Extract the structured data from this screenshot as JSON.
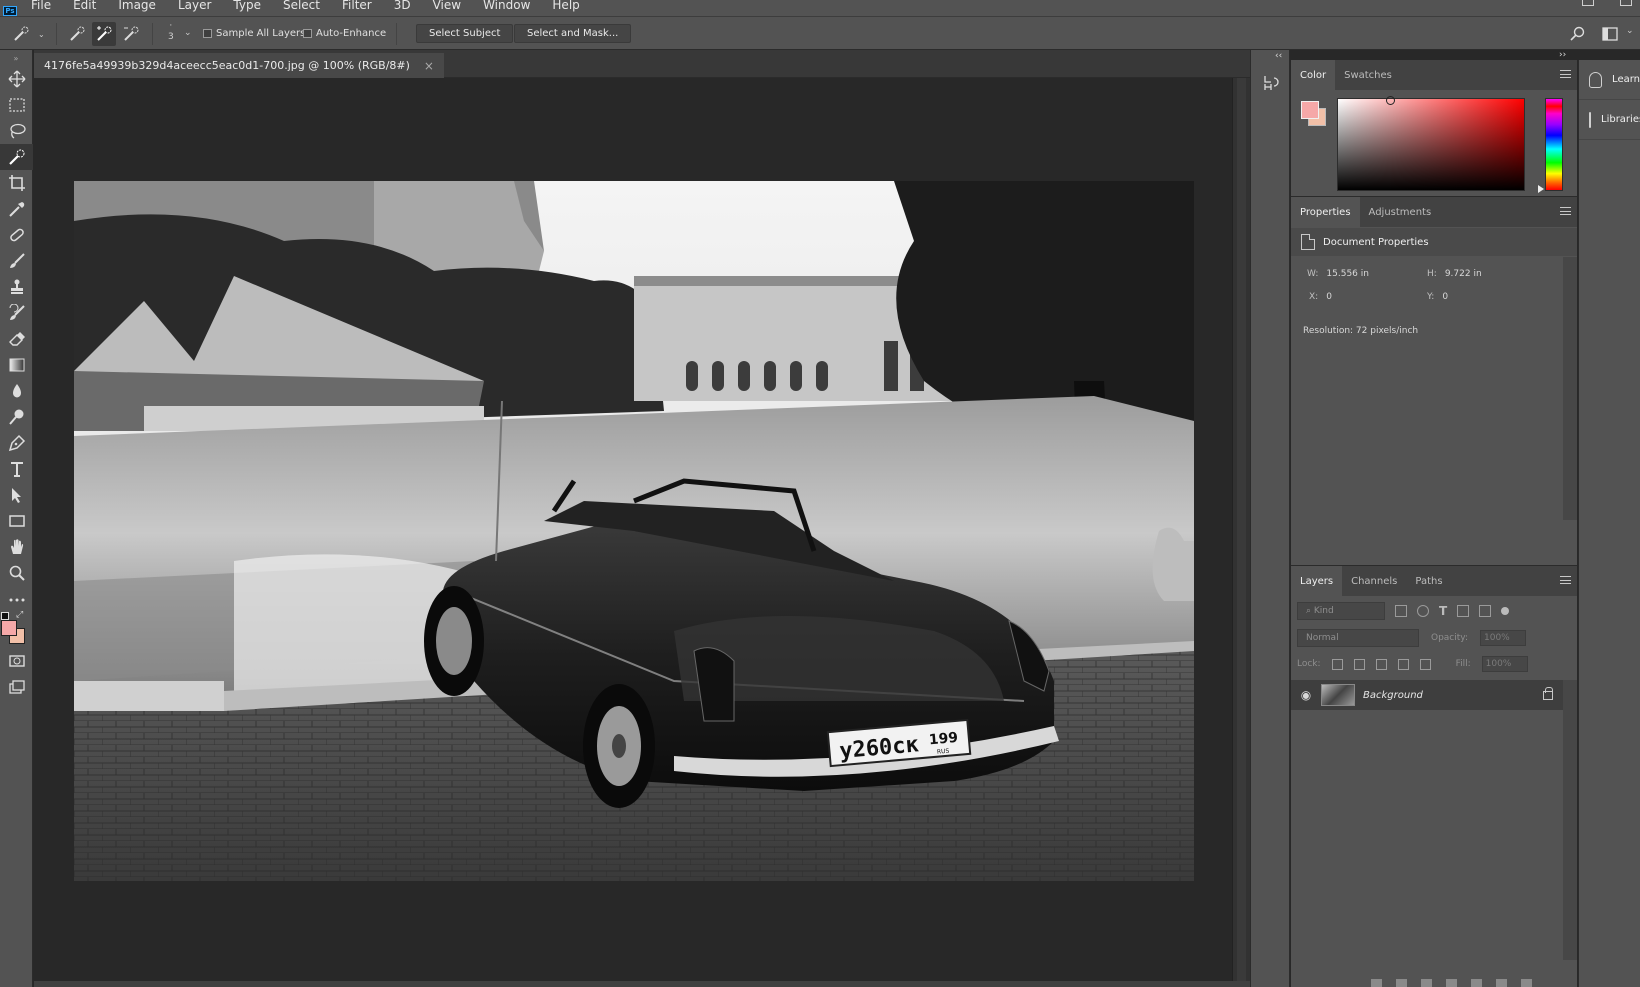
{
  "menu": [
    "File",
    "Edit",
    "Image",
    "Layer",
    "Type",
    "Select",
    "Filter",
    "3D",
    "View",
    "Window",
    "Help"
  ],
  "options": {
    "brush_size": "3",
    "sample_all_layers": "Sample All Layers",
    "auto_enhance": "Auto-Enhance",
    "select_subject": "Select Subject",
    "select_and_mask": "Select and Mask..."
  },
  "document": {
    "tab_title": "4176fe5a49939b329d4aceecc5eac0d1-700.jpg @ 100% (RGB/8#)",
    "close": "×",
    "photo_plate_main": "у260ск",
    "photo_plate_region": "199",
    "photo_plate_country": "RUS"
  },
  "colors": {
    "foreground": "#f5a8a8",
    "background": "#f2c0a8"
  },
  "color_panel": {
    "tabs": [
      "Color",
      "Swatches"
    ]
  },
  "properties_panel": {
    "tabs": [
      "Properties",
      "Adjustments"
    ],
    "header": "Document Properties",
    "w_label": "W:",
    "w_value": "15.556 in",
    "h_label": "H:",
    "h_value": "9.722 in",
    "x_label": "X:",
    "x_value": "0",
    "y_label": "Y:",
    "y_value": "0",
    "resolution": "Resolution: 72 pixels/inch"
  },
  "layers_panel": {
    "tabs": [
      "Layers",
      "Channels",
      "Paths"
    ],
    "kind": "Kind",
    "blend_mode": "Normal",
    "opacity_label": "Opacity:",
    "opacity_value": "100%",
    "lock_label": "Lock:",
    "fill_label": "Fill:",
    "fill_value": "100%",
    "layer_name": "Background"
  },
  "right_panel": {
    "learn": "Learn",
    "libraries": "Libraries"
  }
}
